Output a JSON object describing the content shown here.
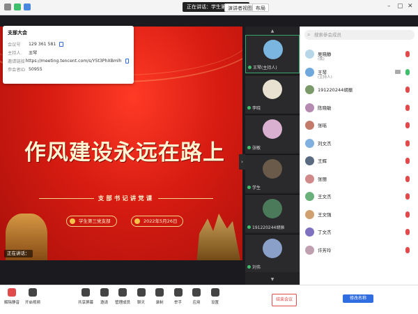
{
  "window": {
    "title": "正在讲话：学生第三党支部"
  },
  "topbar": {
    "view_button": "演讲者视图",
    "layout_button": "布局"
  },
  "meeting_info": {
    "title": "支部大会",
    "rows": [
      {
        "key": "会议号",
        "value": "129 361 581"
      },
      {
        "key": "主持人",
        "value": "王琴"
      },
      {
        "key": "邀请链接",
        "value": "https://meeting.tencent.com/s/Y5t3PhXBmlh"
      },
      {
        "key": "参会者ID",
        "value": "50955"
      }
    ]
  },
  "slide": {
    "title": "作风建设永远在路上",
    "subtitle": "支部书记讲党课",
    "org_pill": "学生第三党支部",
    "date_pill": "2022年5月26日"
  },
  "speaker_tag": "正在讲话：",
  "video_tiles": [
    {
      "name": "王琴(主持人)",
      "color": "#7ab6e0",
      "active": true
    },
    {
      "name": "李晓",
      "color": "#e8e0d0",
      "active": false
    },
    {
      "name": "张敏",
      "color": "#d9b0d0",
      "active": false
    },
    {
      "name": "学生",
      "color": "#6a5a4a",
      "active": false
    },
    {
      "name": "191220244胡振",
      "color": "#4a7a5a",
      "active": false
    },
    {
      "name": "刘伟",
      "color": "#8aa0c8",
      "active": false
    }
  ],
  "participants": {
    "search_placeholder": "搜索参会成员",
    "list": [
      {
        "name": "吴晓静",
        "sub": "(我)",
        "color": "#b7d7e8",
        "mic_on": false,
        "video": false
      },
      {
        "name": "王琴",
        "sub": "(主持人)",
        "color": "#6fa8dc",
        "mic_on": true,
        "video": true
      },
      {
        "name": "191220244胡振",
        "sub": "",
        "color": "#7a9a6a",
        "mic_on": false,
        "video": false
      },
      {
        "name": "陈晓敏",
        "sub": "",
        "color": "#b48ab0",
        "mic_on": false,
        "video": false
      },
      {
        "name": "张瑶",
        "sub": "",
        "color": "#c47a6a",
        "mic_on": false,
        "video": false
      },
      {
        "name": "刘文杰",
        "sub": "",
        "color": "#7fb0e0",
        "mic_on": false,
        "video": false
      },
      {
        "name": "王辉",
        "sub": "",
        "color": "#5a6a80",
        "mic_on": false,
        "video": false
      },
      {
        "name": "张丽",
        "sub": "",
        "color": "#d08a8a",
        "mic_on": false,
        "video": false
      },
      {
        "name": "王文杰",
        "sub": "",
        "color": "#6ab07a",
        "mic_on": false,
        "video": false
      },
      {
        "name": "王文强",
        "sub": "",
        "color": "#d0a070",
        "mic_on": false,
        "video": false
      },
      {
        "name": "丁文杰",
        "sub": "",
        "color": "#8070c0",
        "mic_on": false,
        "video": false
      },
      {
        "name": "许芳玲",
        "sub": "",
        "color": "#c0a0b0",
        "mic_on": false,
        "video": false
      }
    ]
  },
  "toolbar": {
    "left": [
      {
        "name": "unmute-button",
        "label": "解除静音"
      },
      {
        "name": "start-video-button",
        "label": "开启视频"
      }
    ],
    "center": [
      {
        "name": "share-screen-button",
        "label": "共享屏幕"
      },
      {
        "name": "invite-button",
        "label": "邀请"
      },
      {
        "name": "manage-members-button",
        "label": "管理成员"
      },
      {
        "name": "chat-button",
        "label": "聊天"
      },
      {
        "name": "record-button",
        "label": "录制"
      },
      {
        "name": "raise-hand-button",
        "label": "举手"
      },
      {
        "name": "apps-button",
        "label": "应用"
      },
      {
        "name": "settings-button",
        "label": "设置"
      }
    ],
    "end_label": "结束会议",
    "rename_label": "修改名称"
  }
}
